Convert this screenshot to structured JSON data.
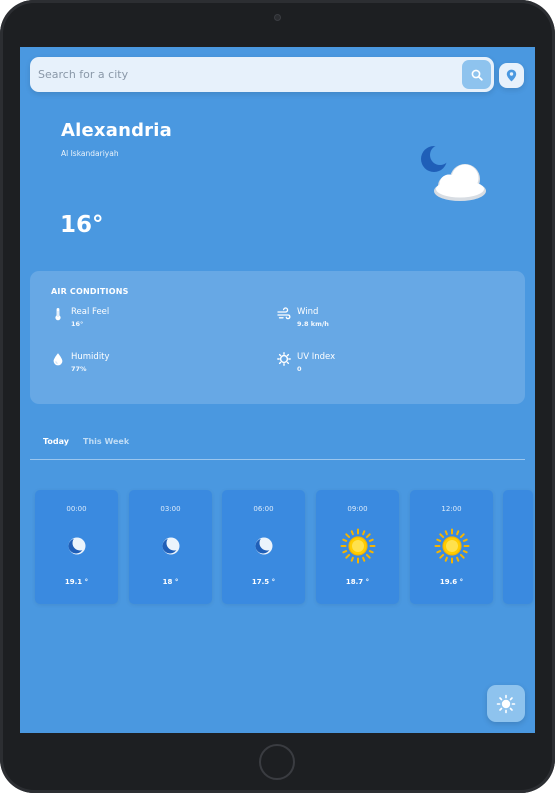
{
  "search": {
    "placeholder": "Search for a city",
    "search_icon": "search-icon",
    "location_icon": "map-pin-icon"
  },
  "current": {
    "city": "Alexandria",
    "region": "Al Iskandariyah",
    "temperature": "16°",
    "condition_icon": "moon-cloud-icon"
  },
  "air_conditions": {
    "title": "AIR CONDITIONS",
    "items": [
      {
        "label": "Real Feel",
        "value": "16°",
        "icon": "thermometer-icon"
      },
      {
        "label": "Wind",
        "value": "9.8 km/h",
        "icon": "wind-icon"
      },
      {
        "label": "Humidity",
        "value": "77%",
        "icon": "droplet-icon"
      },
      {
        "label": "UV Index",
        "value": "0",
        "icon": "sun-outline-icon"
      }
    ]
  },
  "tabs": [
    {
      "label": "Today",
      "active": true
    },
    {
      "label": "This Week",
      "active": false
    }
  ],
  "forecast": [
    {
      "time": "00:00",
      "temp": "19.1 °",
      "icon": "moon-icon"
    },
    {
      "time": "03:00",
      "temp": "18 °",
      "icon": "moon-icon"
    },
    {
      "time": "06:00",
      "temp": "17.5 °",
      "icon": "moon-icon"
    },
    {
      "time": "09:00",
      "temp": "18.7 °",
      "icon": "sun-icon"
    },
    {
      "time": "12:00",
      "temp": "19.6 °",
      "icon": "sun-icon"
    }
  ],
  "theme_toggle": {
    "icon": "sun-toggle-icon"
  },
  "colors": {
    "background": "#4a98e0",
    "card": "#3a8ae0",
    "accent": "#8ec3ee",
    "moon": "#1f5fb8",
    "sun": "#ffcc00"
  }
}
